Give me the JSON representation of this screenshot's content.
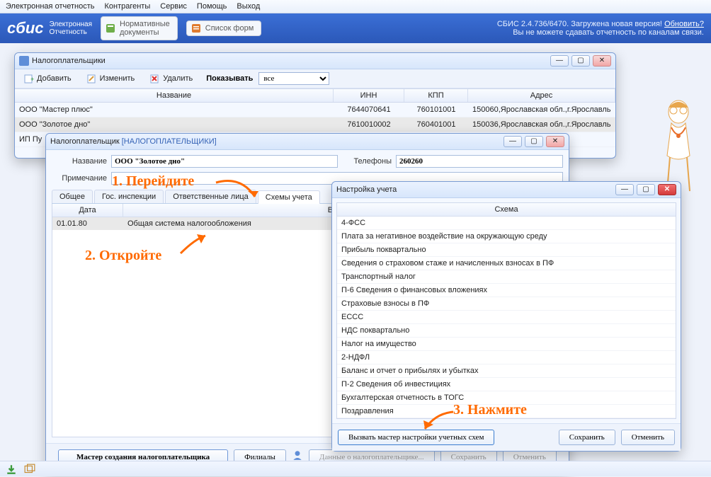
{
  "menubar": [
    "Электронная отчетность",
    "Контрагенты",
    "Сервис",
    "Помощь",
    "Выход"
  ],
  "brand": {
    "logo": "сбис",
    "sub1": "Электронная",
    "sub2": "Отчетность"
  },
  "pills": [
    {
      "line1": "Нормативные",
      "line2": "документы"
    },
    {
      "line1": "Список форм",
      "line2": ""
    }
  ],
  "status": {
    "line1_a": "СБИС 2.4.736/6470. Загружена новая версия! ",
    "line1_link": "Обновить?",
    "line2": "Вы не можете сдавать отчетность по каналам связи."
  },
  "win_taxpayers": {
    "title": "Налогоплательщики",
    "toolbar": {
      "add": "Добавить",
      "edit": "Изменить",
      "del": "Удалить",
      "show": "Показывать",
      "combo": "все"
    },
    "cols": {
      "name": "Название",
      "inn": "ИНН",
      "kpp": "КПП",
      "addr": "Адрес"
    },
    "rows": [
      {
        "name": "ООО \"Мастер плюс\"",
        "inn": "7644070641",
        "kpp": "760101001",
        "addr": "150060,Ярославская обл.,г.Ярославль"
      },
      {
        "name": "ООО \"Золотое дно\"",
        "inn": "7610010002",
        "kpp": "760401001",
        "addr": "150036,Ярославская обл.,г.Ярославль"
      },
      {
        "name": "ИП Пу",
        "inn": "",
        "kpp": "",
        "addr": "рославль"
      }
    ]
  },
  "win_detail": {
    "title_a": "Налогоплательщик ",
    "title_b": "[НАЛОГОПЛАТЕЛЬЩИКИ]",
    "fields": {
      "name_lbl": "Название",
      "name_val": "ООО \"Золотое дно\"",
      "phone_lbl": "Телефоны",
      "phone_val": "260260",
      "note_lbl": "Примечание",
      "note_val": ""
    },
    "tabs": [
      "Общее",
      "Гос. инспекции",
      "Ответственные лица",
      "Схемы учета"
    ],
    "active_tab": 3,
    "grid": {
      "cols": {
        "date": "Дата",
        "kind": "Вид нал"
      },
      "rows": [
        {
          "date": "01.01.80",
          "kind": "Общая система налогообложения"
        }
      ]
    },
    "footer": {
      "wizard": "Мастер создания налогоплательщика",
      "branches": "Филиалы",
      "data": "Данные о налогоплательщике...",
      "save": "Сохранить",
      "cancel": "Отменить"
    }
  },
  "win_scheme": {
    "title": "Настройка учета",
    "header": "Схема",
    "items": [
      "4-ФСС",
      "Плата за негативное воздействие на окружающую среду",
      "Прибыль поквартально",
      "Сведения о страховом стаже и начисленных взносах в ПФ",
      "Транспортный налог",
      "П-6 Сведения о финансовых вложениях",
      "Страховые взносы в ПФ",
      "ЕССС",
      "НДС поквартально",
      "Налог на имущество",
      "2-НДФЛ",
      "Баланс и отчет о прибылях и убытках",
      "П-2 Сведения об инвестициях",
      "Бухгалтерская отчетность в ТОГС",
      "Поздравления"
    ],
    "footer": {
      "wizard": "Вызвать мастер настройки учетных схем",
      "save": "Сохранить",
      "cancel": "Отменить"
    }
  },
  "annotations": {
    "a1": "1. Перейдите",
    "a2": "2. Откройте",
    "a3": "3. Нажмите"
  }
}
